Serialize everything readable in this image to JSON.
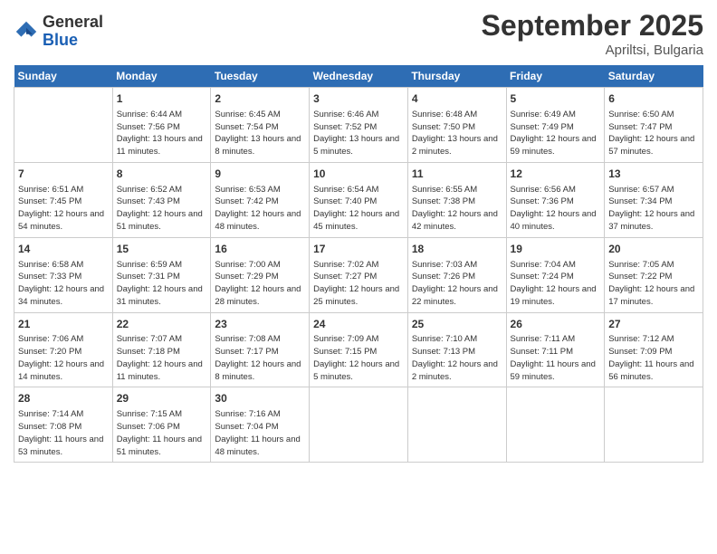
{
  "header": {
    "logo_line1": "General",
    "logo_line2": "Blue",
    "title": "September 2025",
    "subtitle": "Apriltsi, Bulgaria"
  },
  "calendar": {
    "days_of_week": [
      "Sunday",
      "Monday",
      "Tuesday",
      "Wednesday",
      "Thursday",
      "Friday",
      "Saturday"
    ],
    "weeks": [
      [
        {
          "day": "",
          "info": ""
        },
        {
          "day": "1",
          "info": "Sunrise: 6:44 AM\nSunset: 7:56 PM\nDaylight: 13 hours and 11 minutes."
        },
        {
          "day": "2",
          "info": "Sunrise: 6:45 AM\nSunset: 7:54 PM\nDaylight: 13 hours and 8 minutes."
        },
        {
          "day": "3",
          "info": "Sunrise: 6:46 AM\nSunset: 7:52 PM\nDaylight: 13 hours and 5 minutes."
        },
        {
          "day": "4",
          "info": "Sunrise: 6:48 AM\nSunset: 7:50 PM\nDaylight: 13 hours and 2 minutes."
        },
        {
          "day": "5",
          "info": "Sunrise: 6:49 AM\nSunset: 7:49 PM\nDaylight: 12 hours and 59 minutes."
        },
        {
          "day": "6",
          "info": "Sunrise: 6:50 AM\nSunset: 7:47 PM\nDaylight: 12 hours and 57 minutes."
        }
      ],
      [
        {
          "day": "7",
          "info": "Sunrise: 6:51 AM\nSunset: 7:45 PM\nDaylight: 12 hours and 54 minutes."
        },
        {
          "day": "8",
          "info": "Sunrise: 6:52 AM\nSunset: 7:43 PM\nDaylight: 12 hours and 51 minutes."
        },
        {
          "day": "9",
          "info": "Sunrise: 6:53 AM\nSunset: 7:42 PM\nDaylight: 12 hours and 48 minutes."
        },
        {
          "day": "10",
          "info": "Sunrise: 6:54 AM\nSunset: 7:40 PM\nDaylight: 12 hours and 45 minutes."
        },
        {
          "day": "11",
          "info": "Sunrise: 6:55 AM\nSunset: 7:38 PM\nDaylight: 12 hours and 42 minutes."
        },
        {
          "day": "12",
          "info": "Sunrise: 6:56 AM\nSunset: 7:36 PM\nDaylight: 12 hours and 40 minutes."
        },
        {
          "day": "13",
          "info": "Sunrise: 6:57 AM\nSunset: 7:34 PM\nDaylight: 12 hours and 37 minutes."
        }
      ],
      [
        {
          "day": "14",
          "info": "Sunrise: 6:58 AM\nSunset: 7:33 PM\nDaylight: 12 hours and 34 minutes."
        },
        {
          "day": "15",
          "info": "Sunrise: 6:59 AM\nSunset: 7:31 PM\nDaylight: 12 hours and 31 minutes."
        },
        {
          "day": "16",
          "info": "Sunrise: 7:00 AM\nSunset: 7:29 PM\nDaylight: 12 hours and 28 minutes."
        },
        {
          "day": "17",
          "info": "Sunrise: 7:02 AM\nSunset: 7:27 PM\nDaylight: 12 hours and 25 minutes."
        },
        {
          "day": "18",
          "info": "Sunrise: 7:03 AM\nSunset: 7:26 PM\nDaylight: 12 hours and 22 minutes."
        },
        {
          "day": "19",
          "info": "Sunrise: 7:04 AM\nSunset: 7:24 PM\nDaylight: 12 hours and 19 minutes."
        },
        {
          "day": "20",
          "info": "Sunrise: 7:05 AM\nSunset: 7:22 PM\nDaylight: 12 hours and 17 minutes."
        }
      ],
      [
        {
          "day": "21",
          "info": "Sunrise: 7:06 AM\nSunset: 7:20 PM\nDaylight: 12 hours and 14 minutes."
        },
        {
          "day": "22",
          "info": "Sunrise: 7:07 AM\nSunset: 7:18 PM\nDaylight: 12 hours and 11 minutes."
        },
        {
          "day": "23",
          "info": "Sunrise: 7:08 AM\nSunset: 7:17 PM\nDaylight: 12 hours and 8 minutes."
        },
        {
          "day": "24",
          "info": "Sunrise: 7:09 AM\nSunset: 7:15 PM\nDaylight: 12 hours and 5 minutes."
        },
        {
          "day": "25",
          "info": "Sunrise: 7:10 AM\nSunset: 7:13 PM\nDaylight: 12 hours and 2 minutes."
        },
        {
          "day": "26",
          "info": "Sunrise: 7:11 AM\nSunset: 7:11 PM\nDaylight: 11 hours and 59 minutes."
        },
        {
          "day": "27",
          "info": "Sunrise: 7:12 AM\nSunset: 7:09 PM\nDaylight: 11 hours and 56 minutes."
        }
      ],
      [
        {
          "day": "28",
          "info": "Sunrise: 7:14 AM\nSunset: 7:08 PM\nDaylight: 11 hours and 53 minutes."
        },
        {
          "day": "29",
          "info": "Sunrise: 7:15 AM\nSunset: 7:06 PM\nDaylight: 11 hours and 51 minutes."
        },
        {
          "day": "30",
          "info": "Sunrise: 7:16 AM\nSunset: 7:04 PM\nDaylight: 11 hours and 48 minutes."
        },
        {
          "day": "",
          "info": ""
        },
        {
          "day": "",
          "info": ""
        },
        {
          "day": "",
          "info": ""
        },
        {
          "day": "",
          "info": ""
        }
      ]
    ]
  }
}
